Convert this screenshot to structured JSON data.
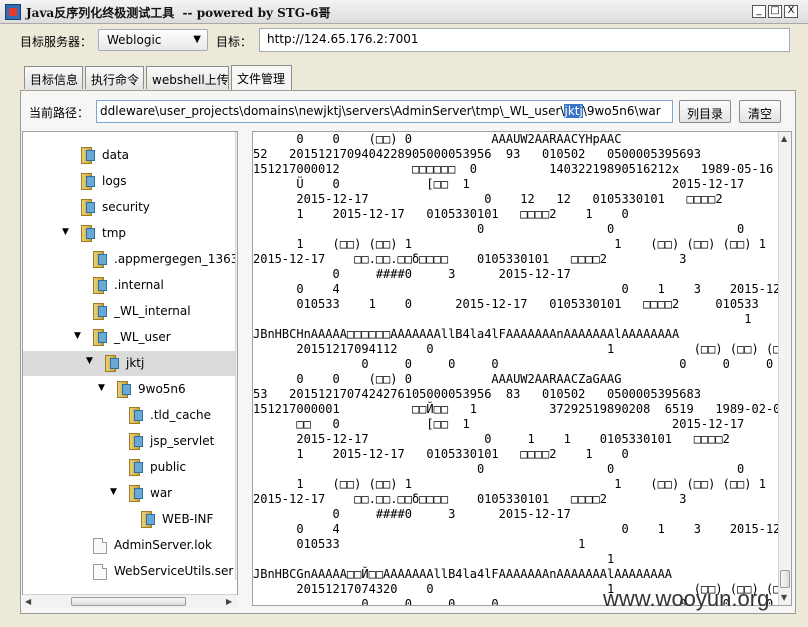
{
  "window": {
    "title": "Java反序列化终极测试工具  -- powered by STG-6哥",
    "minimize": "_",
    "maximize": "□",
    "close": "X"
  },
  "target": {
    "server_label": "目标服务器：",
    "server_value": "Weblogic",
    "target_label": "目标：",
    "target_value": "http://124.65.176.2:7001"
  },
  "tabs": [
    "目标信息",
    "执行命令",
    "webshell上传",
    "文件管理"
  ],
  "path": {
    "label": "当前路径：",
    "before": "ddleware\\user_projects\\domains\\newjktj\\servers\\AdminServer\\tmp\\_WL_user\\",
    "selected": "jktj",
    "after": "\\9wo5n6\\war",
    "list_button": "列目录",
    "clear_button": "清空"
  },
  "tree": [
    {
      "label": "data",
      "type": "folder"
    },
    {
      "label": "logs",
      "type": "folder"
    },
    {
      "label": "security",
      "type": "folder"
    },
    {
      "label": "tmp",
      "type": "folder",
      "open": true
    },
    {
      "label": ".appmergegen_1363",
      "type": "folder"
    },
    {
      "label": ".internal",
      "type": "folder"
    },
    {
      "label": "_WL_internal",
      "type": "folder"
    },
    {
      "label": "_WL_user",
      "type": "folder",
      "open": true
    },
    {
      "label": "jktj",
      "type": "folder",
      "open": true,
      "selected": true
    },
    {
      "label": "9wo5n6",
      "type": "folder",
      "open": true
    },
    {
      "label": ".tld_cache",
      "type": "folder"
    },
    {
      "label": "jsp_servlet",
      "type": "folder"
    },
    {
      "label": "public",
      "type": "folder"
    },
    {
      "label": "war",
      "type": "folder",
      "open": true
    },
    {
      "label": "WEB-INF",
      "type": "folder"
    },
    {
      "label": "AdminServer.lok",
      "type": "file"
    },
    {
      "label": "WebServiceUtils.ser",
      "type": "file"
    }
  ],
  "content_lines": [
    "      0    0    (□□) 0           AAAUW2AARAACYHpAAC",
    "52   2015121709404228905000053956  93   010502   0500005395693",
    "151217000012          □□□□□□  0          14032219890516212x   1989-05-16",
    "      Ü    0            [□□  1                            2015-12-17        1",
    "      2015-12-17                0    12   12   0105330101   □□□□2",
    "      1    2015-12-17   0105330101   □□□□2    1    0                        0",
    "                               0                 0                 0",
    "      1    (□□) (□□) 1                            1    (□□) (□□) (□□) 1",
    "2015-12-17    □□.□□.□□δ□□□□    0105330101   □□□□2          3",
    "           0     ####0     3      2015-12-17",
    "      0    4                                       0    1    3    2015-12-17",
    "      010533    1    0      2015-12-17   0105330101   □□□□2     010533    1",
    "                                                                    1",
    "JBnHBCHnAAAAA□□□□□□AAAAAAAllB4la4lFAAAAAAAnAAAAAAAlAAAAAAAA",
    "      20151217094112    0                        1           (□□) (□□) (□□) 1",
    "               0     0     0     0                         0     0     0     0",
    "      0    0    (□□) 0           AAAUW2AARAACZaGAAG",
    "53   2015121707424276105000053956  83   010502   0500005395683",
    "151217000001          □□Й□□   1          37292519890208  6519   1989-02-08",
    "      □□   0            [□□  1                            2015-12-17        1",
    "      2015-12-17                0     1    1    0105330101   □□□□2",
    "      1    2015-12-17   0105330101   □□□□2    1    0                        0",
    "                               0                 0                 0",
    "      1    (□□) (□□) 1                            1    (□□) (□□) (□□) 1",
    "2015-12-17    □□.□□.□□δ□□□□    0105330101   □□□□2          3",
    "           0     ####0     3      2015-12-17",
    "      0    4                                       0    1    3    2015-12-17",
    "      010533                                 1",
    "                                                 1",
    "JBnHBCGnAAAAA□□Й□□AAAAAAAllB4la4lFAAAAAAAnAAAAAAAlAAAAAAAA",
    "      20151217074320    0                        1           (□□) (□□) (□□) 1",
    "               0     0     0     0                         0     0     0     0"
  ],
  "watermark": "www.wooyun.org"
}
